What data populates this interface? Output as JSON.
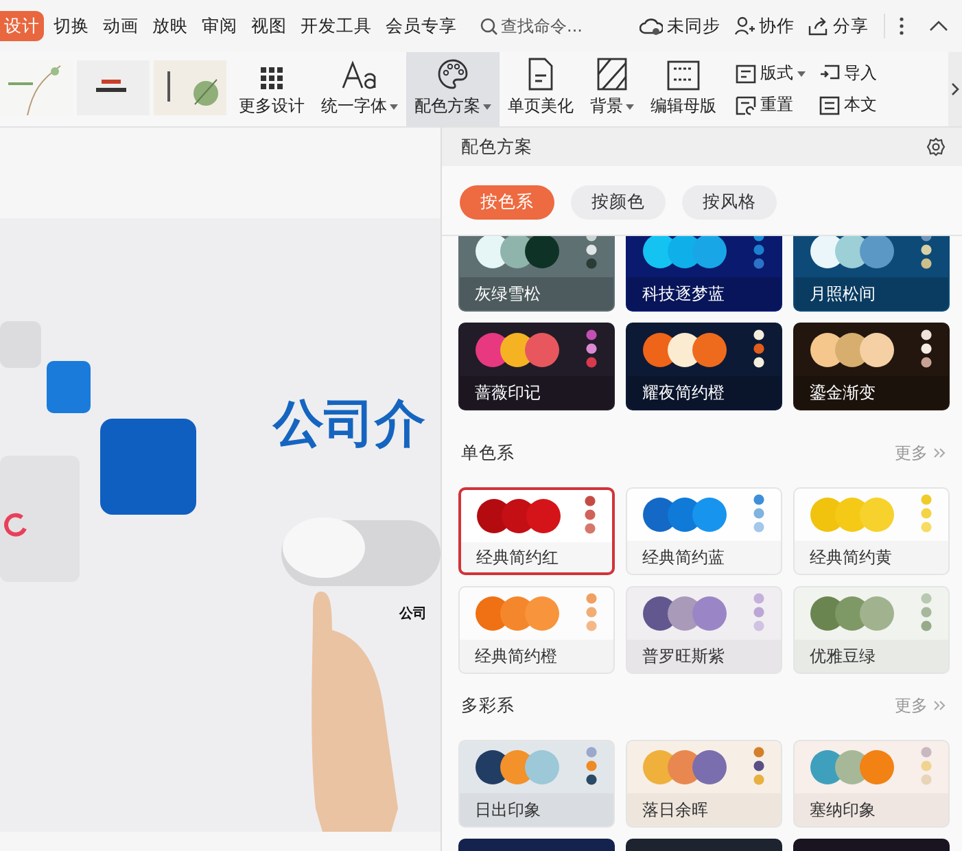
{
  "menu_tabs": [
    {
      "label": "设计",
      "selected": true
    },
    {
      "label": "切换",
      "selected": false
    },
    {
      "label": "动画",
      "selected": false
    },
    {
      "label": "放映",
      "selected": false
    },
    {
      "label": "审阅",
      "selected": false
    },
    {
      "label": "视图",
      "selected": false
    },
    {
      "label": "开发工具",
      "selected": false
    },
    {
      "label": "会员专享",
      "selected": false
    }
  ],
  "search": {
    "placeholder": "查找命令..."
  },
  "top_actions": [
    {
      "kind": "cloud",
      "label": "未同步"
    },
    {
      "kind": "people",
      "label": "协作"
    },
    {
      "kind": "share",
      "label": "分享"
    }
  ],
  "ribbon": [
    {
      "kind": "grid",
      "label": "更多设计",
      "dropdown": false,
      "active": false
    },
    {
      "kind": "font",
      "label": "统一字体",
      "dropdown": true,
      "active": false
    },
    {
      "kind": "palette",
      "label": "配色方案",
      "dropdown": true,
      "active": true
    },
    {
      "kind": "page",
      "label": "单页美化",
      "dropdown": false,
      "active": false
    },
    {
      "kind": "background",
      "label": "背景",
      "dropdown": true,
      "active": false
    },
    {
      "kind": "master",
      "label": "编辑母版",
      "dropdown": false,
      "active": false
    }
  ],
  "ribbon_small": [
    {
      "kind": "layout",
      "label": "版式",
      "dropdown": true
    },
    {
      "kind": "import",
      "label": "导入",
      "dropdown": false
    },
    {
      "kind": "reset",
      "label": "重置",
      "dropdown": false
    },
    {
      "kind": "text",
      "label": "本文",
      "dropdown": false
    }
  ],
  "slide": {
    "title": "公司介",
    "subtitle": "公司"
  },
  "panel": {
    "title": "配色方案",
    "filters": [
      {
        "label": "按色系",
        "selected": true
      },
      {
        "label": "按颜色",
        "selected": false
      },
      {
        "label": "按风格",
        "selected": false
      }
    ],
    "groups": [
      {
        "cards": [
          {
            "name": "灰绿雪松",
            "color": "#5f7073",
            "circles": [
              {
                "color": "#e6f6f7"
              },
              {
                "color": "#8fb4ac"
              },
              {
                "color": "#0e3326"
              }
            ],
            "dots": [
              {
                "color": "#c9d3d2"
              },
              {
                "color": "#dfe6e5"
              },
              {
                "color": "#2b3b36"
              }
            ],
            "selected": false
          },
          {
            "name": "科技逐梦蓝",
            "color": "#0a1a6e",
            "circles": [
              {
                "color": "#14c3f2"
              },
              {
                "color": "#0fb0ea"
              },
              {
                "color": "#19a6e6"
              }
            ],
            "dots": [
              {
                "color": "#1a8fd8"
              },
              {
                "color": "#1c7fd0"
              },
              {
                "color": "#2a73c8"
              }
            ],
            "selected": false
          },
          {
            "name": "月照松间",
            "color": "#0d4a78",
            "circles": [
              {
                "color": "#eaf6fa"
              },
              {
                "color": "#9ccfd6"
              },
              {
                "color": "#5b98c6"
              }
            ],
            "dots": [
              {
                "color": "#6f95b8"
              },
              {
                "color": "#d8d0a4"
              },
              {
                "color": "#cdbf8a"
              }
            ],
            "selected": false
          },
          {
            "name": "蔷薇印记",
            "color": "#211c28",
            "circles": [
              {
                "color": "#e8387f"
              },
              {
                "color": "#f5b323"
              },
              {
                "color": "#e8575e"
              }
            ],
            "dots": [
              {
                "color": "#c24fb2"
              },
              {
                "color": "#d98ad1"
              },
              {
                "color": "#d8394d"
              }
            ],
            "selected": false
          },
          {
            "name": "耀夜简约橙",
            "color": "#0d1a36",
            "circles": [
              {
                "color": "#ee6418"
              },
              {
                "color": "#fbebd0"
              },
              {
                "color": "#ee6b1e"
              }
            ],
            "dots": [
              {
                "color": "#f3eedc"
              },
              {
                "color": "#e25d1b"
              },
              {
                "color": "#f3eedd"
              }
            ],
            "selected": false
          },
          {
            "name": "鎏金渐变",
            "color": "#22160f",
            "circles": [
              {
                "color": "#f5c78c"
              },
              {
                "color": "#d8ae6f"
              },
              {
                "color": "#f4d0a4"
              }
            ],
            "dots": [
              {
                "color": "#efe3dc"
              },
              {
                "color": "#f5ece4"
              },
              {
                "color": "#c8a294"
              }
            ],
            "selected": false
          }
        ]
      },
      {
        "title": "单色系",
        "more": "更多",
        "cards": [
          {
            "name": "经典简约红",
            "color": "#ffffff",
            "circles": [
              {
                "color": "#b40b10"
              },
              {
                "color": "#c40f14"
              },
              {
                "color": "#d51419"
              }
            ],
            "dots": [
              {
                "color": "#c74b45"
              },
              {
                "color": "#d0635a"
              },
              {
                "color": "#d7776b"
              }
            ],
            "selected": true
          },
          {
            "name": "经典简约蓝",
            "color": "#fefefe",
            "circles": [
              {
                "color": "#1469c6"
              },
              {
                "color": "#0f7ad8"
              },
              {
                "color": "#1794ee"
              }
            ],
            "dots": [
              {
                "color": "#3c8fd8"
              },
              {
                "color": "#7fb3e0"
              },
              {
                "color": "#a3c8ea"
              }
            ],
            "selected": false
          },
          {
            "name": "经典简约黄",
            "color": "#fdfdfd",
            "circles": [
              {
                "color": "#f1c20e"
              },
              {
                "color": "#f4ca16"
              },
              {
                "color": "#f7d22c"
              }
            ],
            "dots": [
              {
                "color": "#f0cc2a"
              },
              {
                "color": "#f3d444"
              },
              {
                "color": "#f6dc62"
              }
            ],
            "selected": false
          },
          {
            "name": "经典简约橙",
            "color": "#fcfcfc",
            "circles": [
              {
                "color": "#f07014"
              },
              {
                "color": "#f4872c"
              },
              {
                "color": "#f7943c"
              }
            ],
            "dots": [
              {
                "color": "#f0a060"
              },
              {
                "color": "#f2ad74"
              },
              {
                "color": "#f4b888"
              }
            ],
            "selected": false
          },
          {
            "name": "普罗旺斯紫",
            "color": "#f1eef2",
            "circles": [
              {
                "color": "#62588f"
              },
              {
                "color": "#a89ab8"
              },
              {
                "color": "#9a86c6"
              }
            ],
            "dots": [
              {
                "color": "#c4b0dc"
              },
              {
                "color": "#bba6d6"
              },
              {
                "color": "#d0c2e2"
              }
            ],
            "selected": false
          },
          {
            "name": "优雅豆绿",
            "color": "#f1f3ef",
            "circles": [
              {
                "color": "#6b8550"
              },
              {
                "color": "#7f9966"
              },
              {
                "color": "#a1b38e"
              }
            ],
            "dots": [
              {
                "color": "#b9c8b0"
              },
              {
                "color": "#a7b89c"
              },
              {
                "color": "#97ab8a"
              }
            ],
            "selected": false
          }
        ]
      },
      {
        "title": "多彩系",
        "more": "更多",
        "cards": [
          {
            "name": "日出印象",
            "color": "#e1e6ea",
            "circles": [
              {
                "color": "#213d63"
              },
              {
                "color": "#f3912a"
              },
              {
                "color": "#9cc8d8"
              }
            ],
            "dots": [
              {
                "color": "#9aa8cc"
              },
              {
                "color": "#ef8a24"
              },
              {
                "color": "#2b4a66"
              }
            ],
            "selected": false
          },
          {
            "name": "落日余晖",
            "color": "#f7efe6",
            "circles": [
              {
                "color": "#efb03c"
              },
              {
                "color": "#e88850"
              },
              {
                "color": "#7a6eae"
              }
            ],
            "dots": [
              {
                "color": "#d4802a"
              },
              {
                "color": "#5b4f86"
              },
              {
                "color": "#e8b040"
              }
            ],
            "selected": false
          },
          {
            "name": "塞纳印象",
            "color": "#f8eeea",
            "circles": [
              {
                "color": "#3ea0bc"
              },
              {
                "color": "#a6b898"
              },
              {
                "color": "#f28214"
              }
            ],
            "dots": [
              {
                "color": "#c9b8c0"
              },
              {
                "color": "#f1d390"
              },
              {
                "color": "#e8d4b8"
              }
            ],
            "selected": false
          },
          {
            "color": "#14234e",
            "selected": false
          },
          {
            "color": "#1d2430",
            "selected": false
          },
          {
            "color": "#1a1420",
            "selected": false
          }
        ]
      }
    ]
  }
}
